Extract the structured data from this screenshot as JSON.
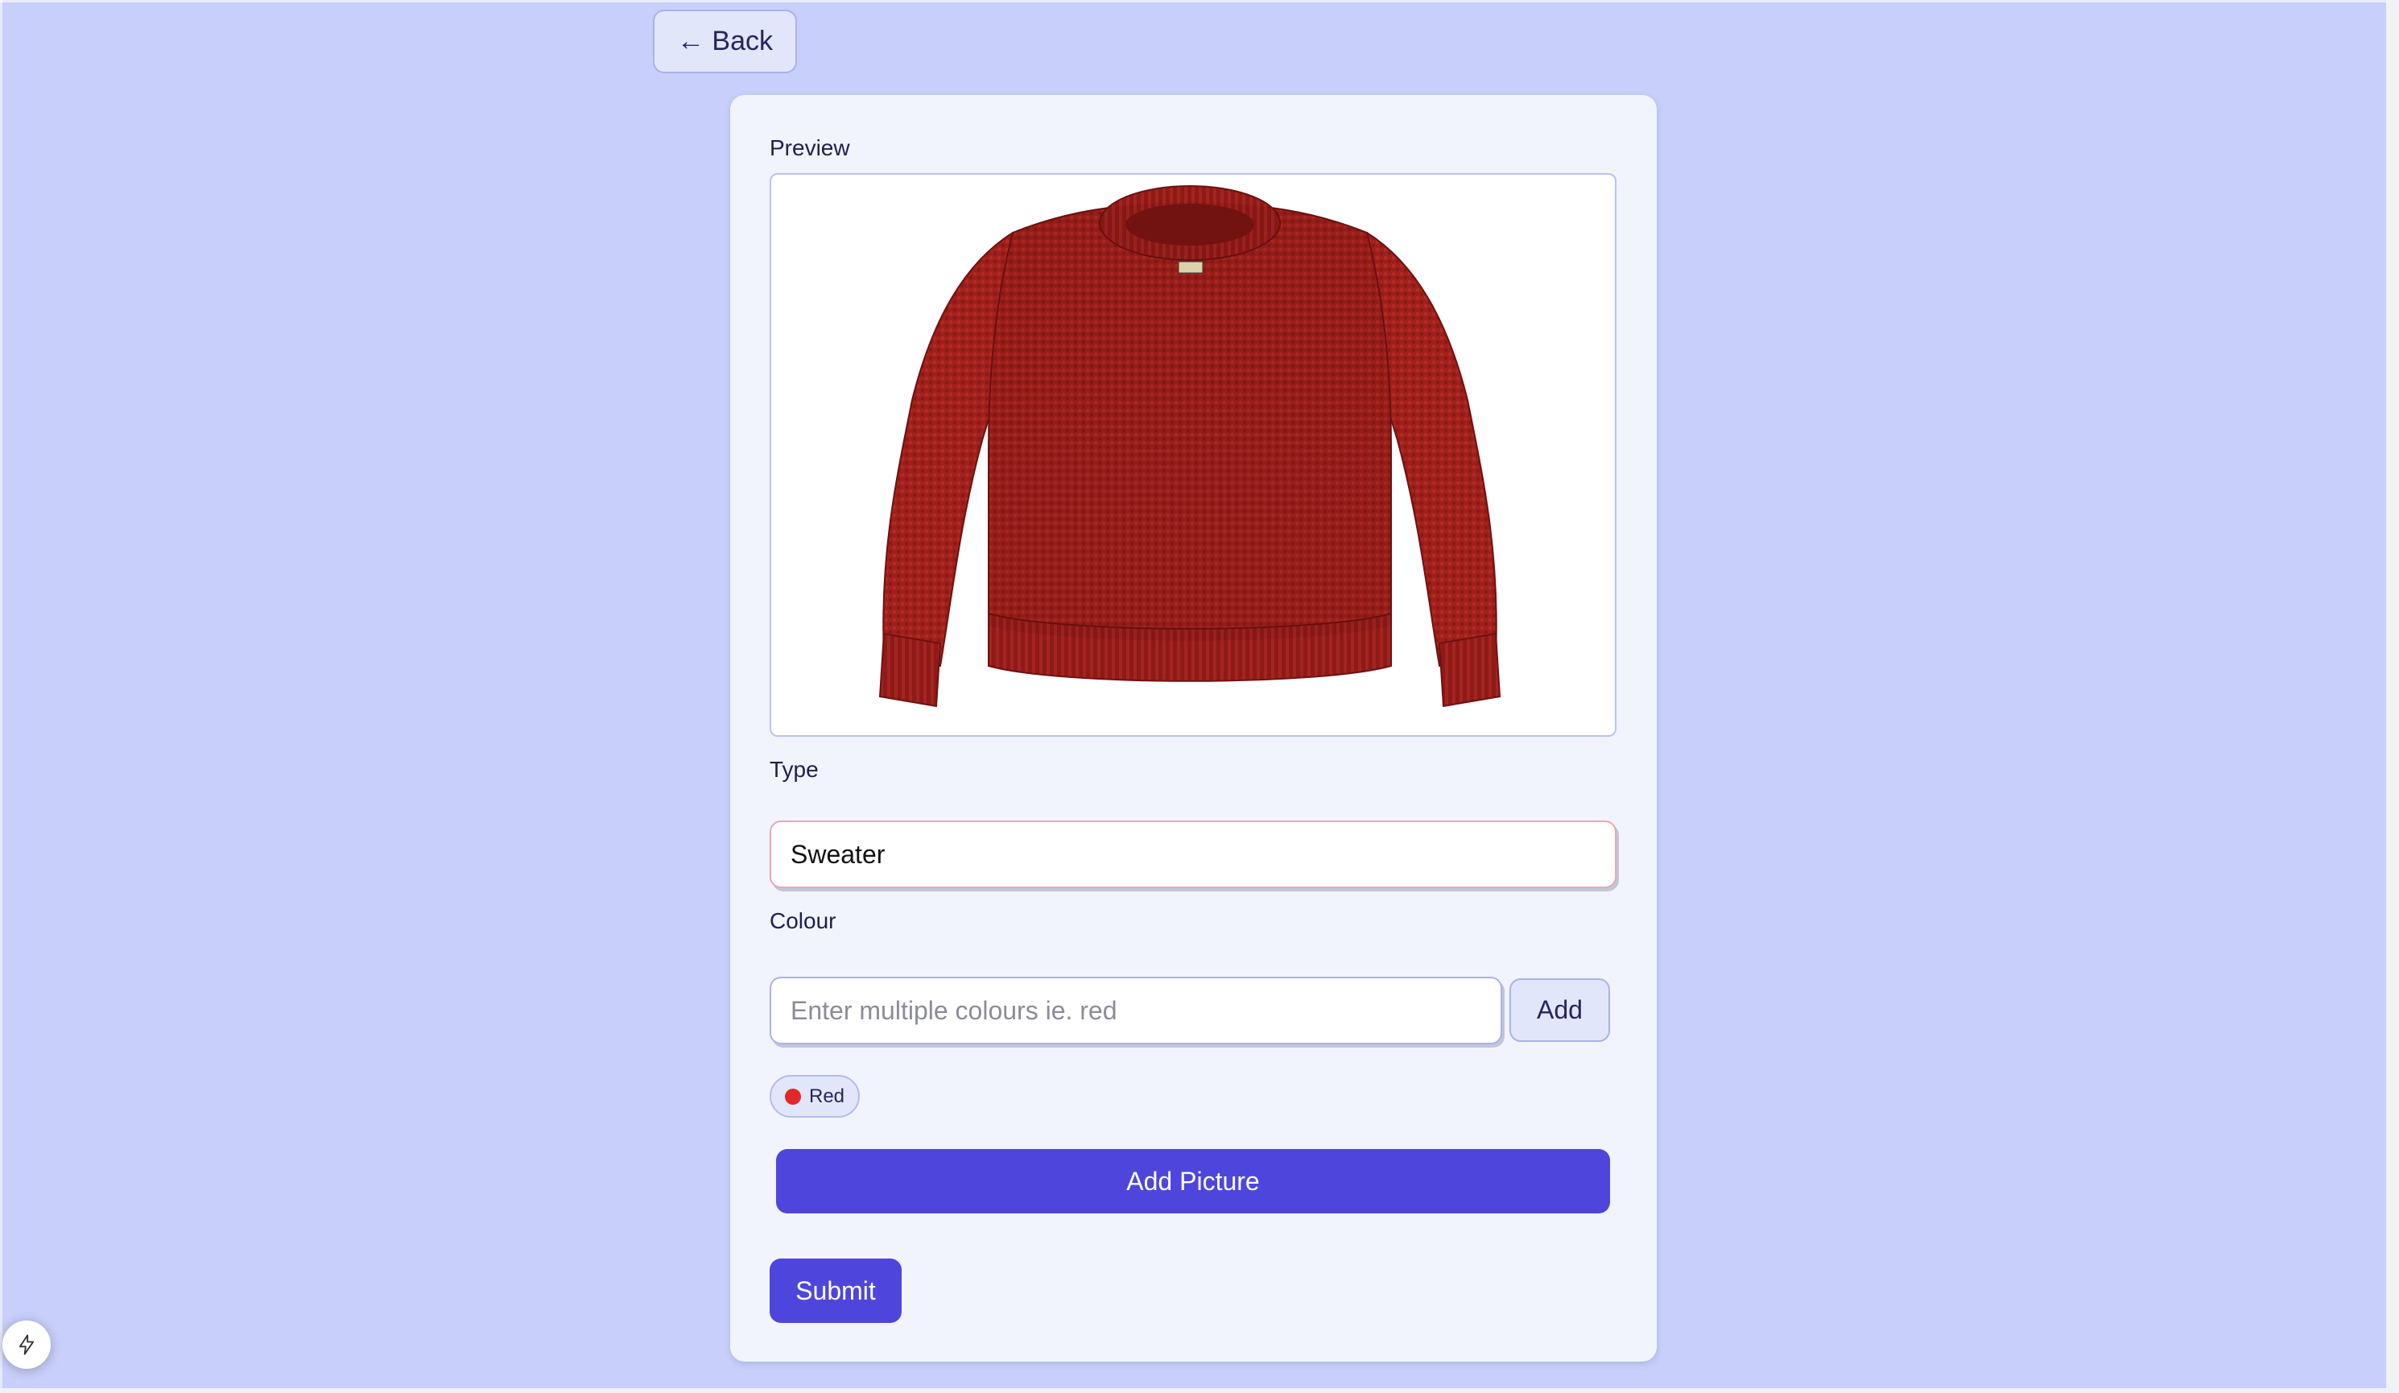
{
  "nav": {
    "back_label": "← Back"
  },
  "form": {
    "preview_label": "Preview",
    "preview_image_alt": "sweater-image",
    "type_label": "Type",
    "type_value": "Sweater",
    "colour_label": "Colour",
    "colour_placeholder": "Enter multiple colours ie. red",
    "add_colour_label": "Add",
    "colour_chips": [
      {
        "label": "Red",
        "color": "#e02a2a"
      }
    ],
    "add_picture_label": "Add Picture",
    "submit_label": "Submit"
  },
  "floating": {
    "icon": "lightning-icon"
  },
  "colors": {
    "background": "#c7cffa",
    "card": "#f1f4fd",
    "primary": "#4e46dc",
    "secondary_button": "#e2e6fb",
    "border": "#a9b2ec",
    "text_dark": "#26255c",
    "invalid_border": "#eaa9b0"
  }
}
